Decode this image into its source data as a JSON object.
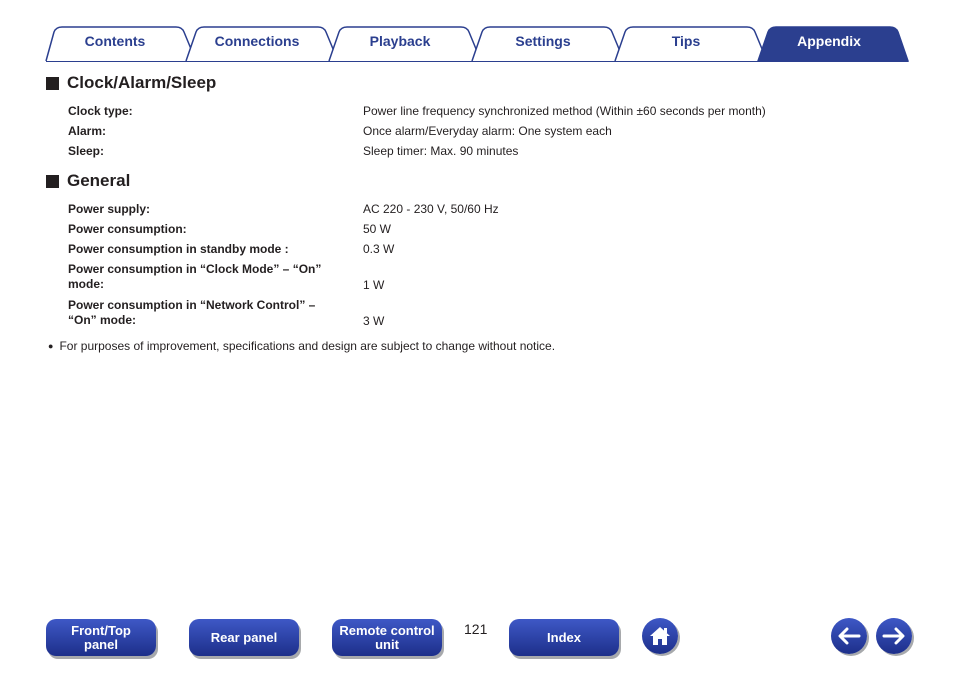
{
  "tabs": [
    {
      "label": "Contents",
      "active": false
    },
    {
      "label": "Connections",
      "active": false
    },
    {
      "label": "Playback",
      "active": false
    },
    {
      "label": "Settings",
      "active": false
    },
    {
      "label": "Tips",
      "active": false
    },
    {
      "label": "Appendix",
      "active": true
    }
  ],
  "colors": {
    "accent": "#2b3f8f",
    "tab_border": "#2b3f8f",
    "active_tab": "#2b3f8f",
    "button_top": "#3e58c6",
    "button_bottom": "#1d2f8a"
  },
  "sections": [
    {
      "title": "Clock/Alarm/Sleep",
      "rows": [
        {
          "label": "Clock type:",
          "value": "Power line frequency synchronized method (Within ±60 seconds per month)"
        },
        {
          "label": "Alarm:",
          "value": "Once alarm/Everyday alarm: One system each"
        },
        {
          "label": "Sleep:",
          "value": "Sleep timer: Max. 90 minutes"
        }
      ]
    },
    {
      "title": "General",
      "rows": [
        {
          "label": "Power supply:",
          "value": "AC 220 - 230 V, 50/60 Hz"
        },
        {
          "label": "Power consumption:",
          "value": "50 W"
        },
        {
          "label": "Power consumption in standby mode :",
          "value": "0.3 W"
        },
        {
          "label_line1": "Power consumption in “Clock Mode” – “On”",
          "label_line2": "mode:",
          "value": "1 W"
        },
        {
          "label_line1": "Power consumption in “Network Control” –",
          "label_line2": "“On” mode:",
          "value": "3 W"
        }
      ]
    }
  ],
  "note": "For purposes of improvement, specifications and design are subject to change without notice.",
  "bottom_nav": {
    "front_top_panel_line1": "Front/Top",
    "front_top_panel_line2": "panel",
    "rear_panel": "Rear panel",
    "remote_control_unit_line1": "Remote control",
    "remote_control_unit_line2": "unit",
    "page_number": "121",
    "index": "Index",
    "icons": [
      "home-icon",
      "arrow-left-icon",
      "arrow-right-icon"
    ]
  }
}
